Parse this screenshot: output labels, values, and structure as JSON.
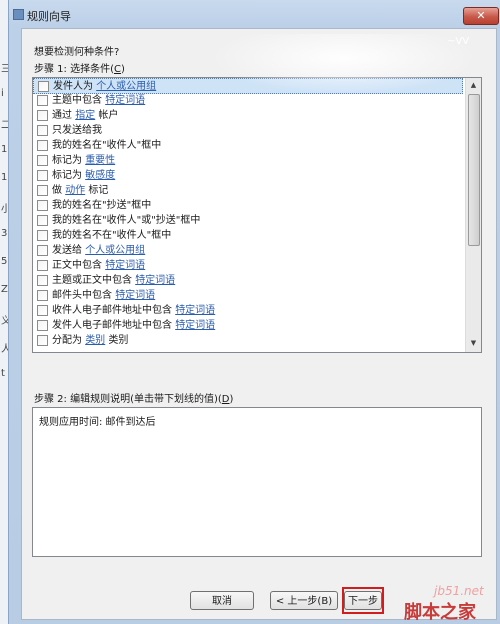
{
  "left_strip": [
    "三",
    "i",
    "二",
    "1",
    "1",
    "小",
    "3",
    "5",
    "Z",
    "义",
    "人",
    "t"
  ],
  "window": {
    "title": "规则向导",
    "close_glyph": "✕"
  },
  "top_right_mark": "~VV",
  "question": "想要检测何种条件?",
  "step1": {
    "prefix": "步骤 1: 选择条件(",
    "accel": "C",
    "suffix": ")"
  },
  "conditions": [
    {
      "before": "发件人为 ",
      "link": "个人或公用组",
      "after": "",
      "selected": true
    },
    {
      "before": "主题中包含 ",
      "link": "特定词语",
      "after": ""
    },
    {
      "before": "通过 ",
      "link": "指定",
      "after": " 帐户"
    },
    {
      "before": "只发送给我",
      "link": "",
      "after": ""
    },
    {
      "before": "我的姓名在\"收件人\"框中",
      "link": "",
      "after": ""
    },
    {
      "before": "标记为 ",
      "link": "重要性",
      "after": ""
    },
    {
      "before": "标记为 ",
      "link": "敏感度",
      "after": ""
    },
    {
      "before": "做 ",
      "link": "动作",
      "after": " 标记"
    },
    {
      "before": "我的姓名在\"抄送\"框中",
      "link": "",
      "after": ""
    },
    {
      "before": "我的姓名在\"收件人\"或\"抄送\"框中",
      "link": "",
      "after": ""
    },
    {
      "before": "我的姓名不在\"收件人\"框中",
      "link": "",
      "after": ""
    },
    {
      "before": "发送给 ",
      "link": "个人或公用组",
      "after": ""
    },
    {
      "before": "正文中包含 ",
      "link": "特定词语",
      "after": ""
    },
    {
      "before": "主题或正文中包含 ",
      "link": "特定词语",
      "after": ""
    },
    {
      "before": "邮件头中包含 ",
      "link": "特定词语",
      "after": ""
    },
    {
      "before": "收件人电子邮件地址中包含 ",
      "link": "特定词语",
      "after": ""
    },
    {
      "before": "发件人电子邮件地址中包含 ",
      "link": "特定词语",
      "after": ""
    },
    {
      "before": "分配为 ",
      "link": "类别",
      "after": " 类别"
    }
  ],
  "step2": {
    "prefix": "步骤 2: 编辑规则说明(单击带下划线的值)(",
    "accel": "D",
    "suffix": ")"
  },
  "rule_description": "规则应用时间: 邮件到达后",
  "buttons": {
    "cancel": "取消",
    "back": "< 上一步(B)",
    "next": "下一步"
  },
  "watermark": {
    "site": "jb51.net",
    "brand": "脚本之家"
  }
}
